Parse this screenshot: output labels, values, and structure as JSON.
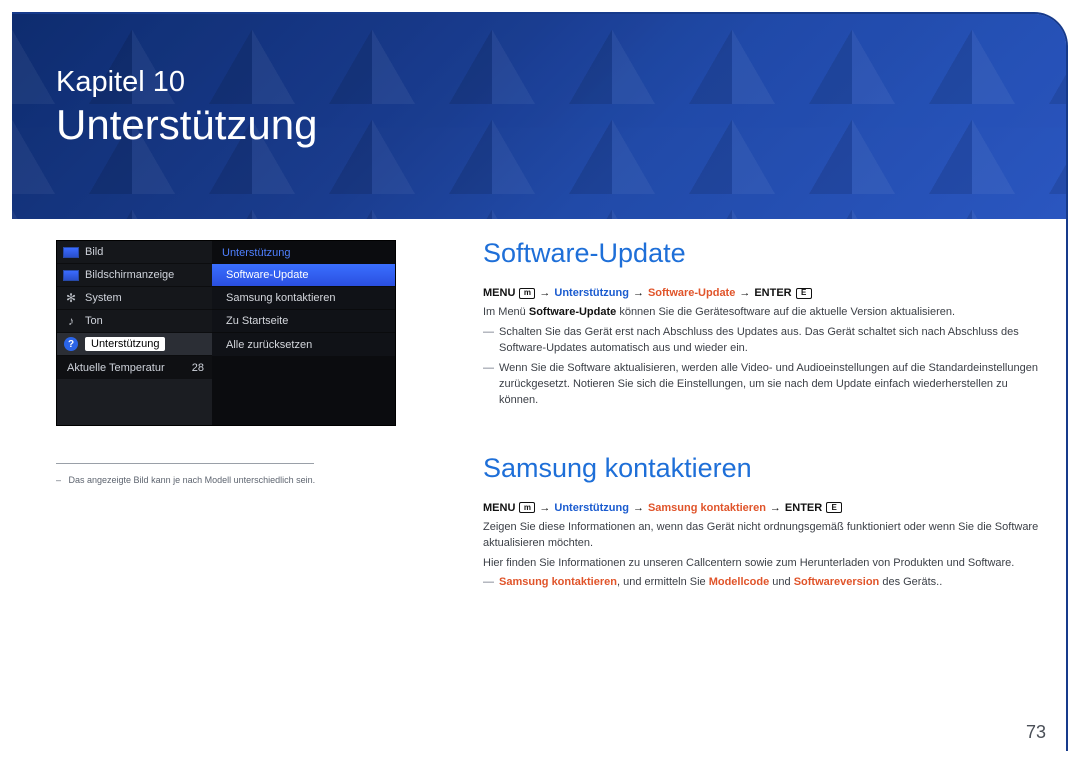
{
  "chapter": {
    "kicker": "Kapitel 10",
    "title": "Unterstützung"
  },
  "tv": {
    "left": {
      "items": [
        {
          "label": "Bild"
        },
        {
          "label": "Bildschirmanzeige"
        },
        {
          "label": "System"
        },
        {
          "label": "Ton"
        },
        {
          "label": "Unterstützung"
        }
      ],
      "temp_label": "Aktuelle Temperatur",
      "temp_value": "28"
    },
    "right": {
      "header": "Unterstützung",
      "items": [
        {
          "label": "Software-Update"
        },
        {
          "label": "Samsung kontaktieren"
        },
        {
          "label": "Zu Startseite"
        },
        {
          "label": "Alle zurücksetzen"
        }
      ]
    }
  },
  "caption": "Das angezeigte Bild kann je nach Modell unterschiedlich sein.",
  "sw": {
    "heading": "Software-Update",
    "nav": {
      "menu": "MENU",
      "p1": "Unterstützung",
      "p2": "Software-Update",
      "enter": "ENTER"
    },
    "l1a": "Im Menü ",
    "l1b": "Software-Update",
    "l1c": " können Sie die Gerätesoftware auf die aktuelle Version aktualisieren.",
    "n1": "Schalten Sie das Gerät erst nach Abschluss des Updates aus. Das Gerät schaltet sich nach Abschluss des Software-Updates automatisch aus und wieder ein.",
    "n2": "Wenn Sie die Software aktualisieren, werden alle Video- und Audioeinstellungen auf die Standardeinstellungen zurückgesetzt. Notieren Sie sich die Einstellungen, um sie nach dem Update einfach wiederherstellen zu können."
  },
  "sk": {
    "heading": "Samsung kontaktieren",
    "nav": {
      "menu": "MENU",
      "p1": "Unterstützung",
      "p2": "Samsung kontaktieren",
      "enter": "ENTER"
    },
    "l1": "Zeigen Sie diese Informationen an, wenn das Gerät nicht ordnungsgemäß funktioniert oder wenn Sie die Software aktualisieren möchten.",
    "l2": "Hier finden Sie Informationen zu unseren Callcentern sowie zum Herunterladen von Produkten und Software.",
    "n_a": "Samsung kontaktieren",
    "n_b": ", und ermitteln Sie ",
    "n_c": "Modellcode",
    "n_d": " und ",
    "n_e": "Softwareversion",
    "n_f": " des Geräts.."
  },
  "page_number": "73",
  "glyphs": {
    "arrow": "→",
    "tick": "―",
    "menu_icon": "m",
    "enter_icon": "E",
    "question": "?",
    "gear": "✻",
    "speaker": "♪"
  }
}
